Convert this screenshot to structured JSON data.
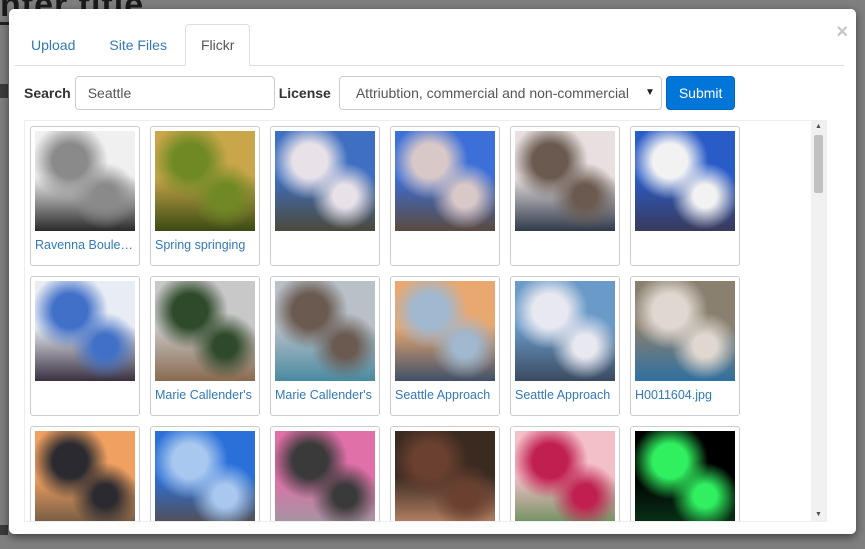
{
  "tabs": [
    {
      "label": "Upload"
    },
    {
      "label": "Site Files"
    },
    {
      "label": "Flickr"
    }
  ],
  "active_tab": "Flickr",
  "close_glyph": "×",
  "search": {
    "label": "Search",
    "value": "Seattle"
  },
  "license": {
    "label": "License",
    "value": "Attriubtion, commercial and non-commercial"
  },
  "submit_label": "Submit",
  "photos": [
    {
      "caption": "Ravenna Boulevard",
      "palette": [
        "#f0f0f0",
        "#8a8a8a",
        "#2a2a2a"
      ]
    },
    {
      "caption": "Spring springing",
      "palette": [
        "#c9a64a",
        "#6f8a24",
        "#3a4a14"
      ]
    },
    {
      "caption": "",
      "palette": [
        "#3f6fc0",
        "#e8e2e8",
        "#4a4a3a"
      ]
    },
    {
      "caption": "",
      "palette": [
        "#3c6fd8",
        "#d9c8c8",
        "#5a4a40"
      ]
    },
    {
      "caption": "",
      "palette": [
        "#e8e0e0",
        "#6a5a50",
        "#2f3a4a"
      ]
    },
    {
      "caption": "",
      "palette": [
        "#2a5cc8",
        "#f2f2f2",
        "#3a3a5a"
      ]
    },
    {
      "caption": "",
      "palette": [
        "#e8ecf4",
        "#4070c8",
        "#3a3040"
      ]
    },
    {
      "caption": "Marie Callender's",
      "palette": [
        "#c8c8c8",
        "#2f4a2a",
        "#8a6a50"
      ]
    },
    {
      "caption": "Marie Callender's",
      "palette": [
        "#b8c0c8",
        "#6a5a50",
        "#4a8aa0"
      ]
    },
    {
      "caption": "Seattle Approach",
      "palette": [
        "#e8a870",
        "#a0b8d0",
        "#405068"
      ]
    },
    {
      "caption": "Seattle Approach",
      "palette": [
        "#6a9ac8",
        "#e8e8f0",
        "#3a4a60"
      ]
    },
    {
      "caption": "H0011604.jpg",
      "palette": [
        "#8a8070",
        "#e0d8d0",
        "#3070a0"
      ]
    },
    {
      "caption": "",
      "palette": [
        "#f0a060",
        "#2a2a30",
        "#605040"
      ]
    },
    {
      "caption": "",
      "palette": [
        "#2a70d8",
        "#a8c8f0",
        "#5a4a40"
      ]
    },
    {
      "caption": "",
      "palette": [
        "#e070a8",
        "#3a3a3a",
        "#9a9aa0"
      ]
    },
    {
      "caption": "",
      "palette": [
        "#3a2a20",
        "#6a4030",
        "#c89070"
      ]
    },
    {
      "caption": "",
      "palette": [
        "#f4c0c8",
        "#c02050",
        "#5a8a50"
      ]
    },
    {
      "caption": "",
      "palette": [
        "#000000",
        "#30f060",
        "#0a3a1a"
      ]
    }
  ]
}
